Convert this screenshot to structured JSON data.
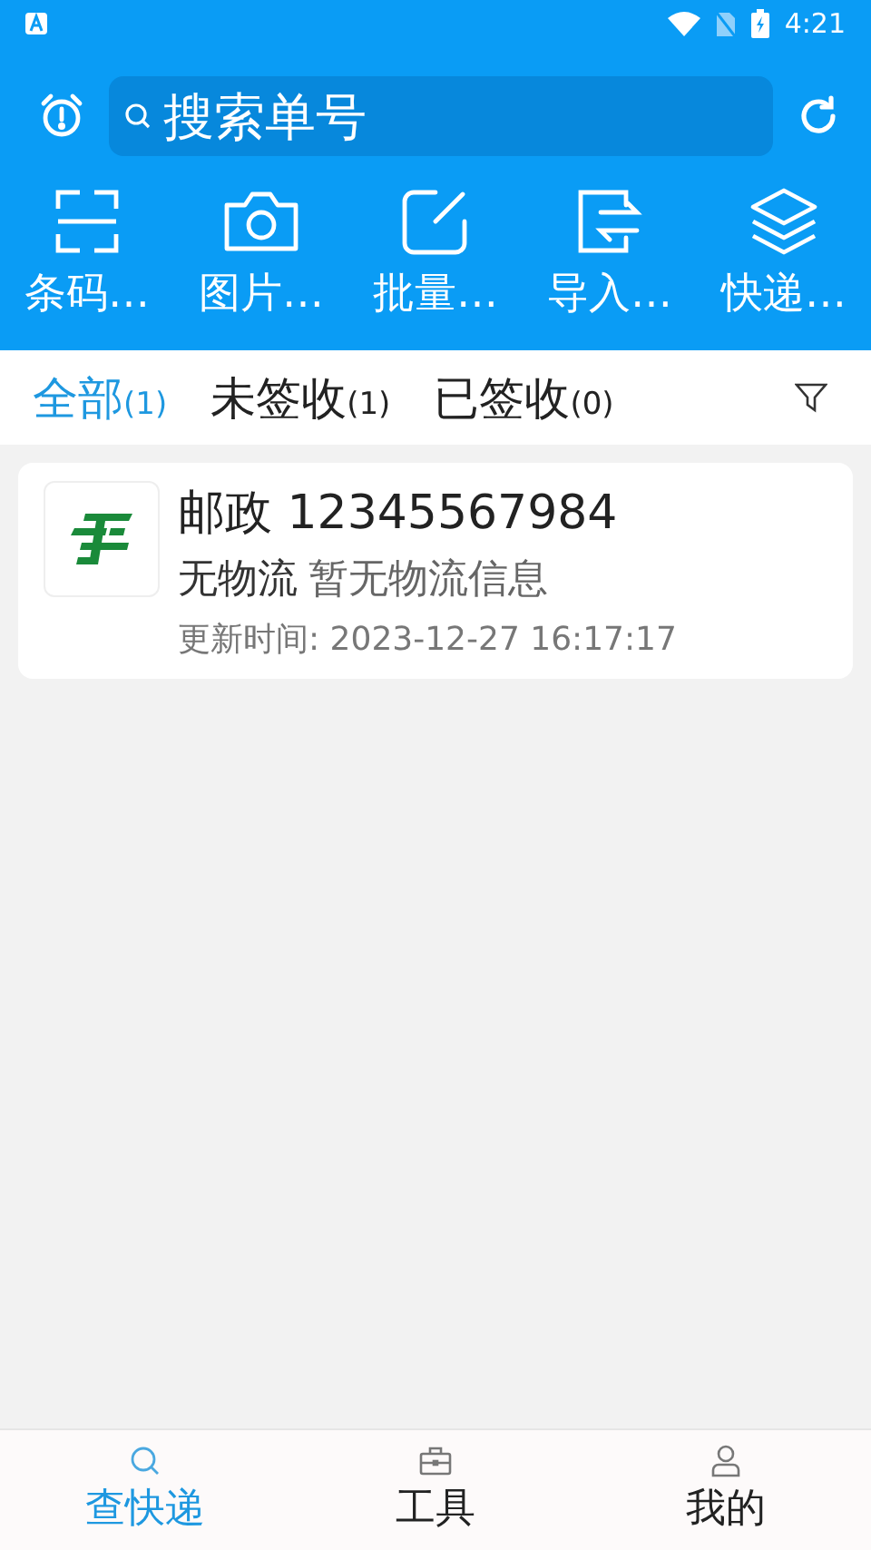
{
  "status_bar": {
    "time": "4:21"
  },
  "search": {
    "placeholder": "搜索单号"
  },
  "tools": [
    {
      "kind": "scan",
      "label": "条码…"
    },
    {
      "kind": "camera",
      "label": "图片…"
    },
    {
      "kind": "edit",
      "label": "批量…"
    },
    {
      "kind": "import",
      "label": "导入…"
    },
    {
      "kind": "layers",
      "label": "快递…"
    }
  ],
  "tabs": [
    {
      "label": "全部",
      "count": "(1)",
      "selected": true
    },
    {
      "label": "未签收",
      "count": "(1)",
      "selected": false
    },
    {
      "label": "已签收",
      "count": "(0)",
      "selected": false
    }
  ],
  "parcels": [
    {
      "carrier": "邮政",
      "number": "12345567984",
      "status": "无物流",
      "detail": "暂无物流信息",
      "updated": "更新时间: 2023-12-27 16:17:17"
    }
  ],
  "bottom_nav": [
    {
      "kind": "search",
      "label": "查快递",
      "selected": true
    },
    {
      "kind": "toolbox",
      "label": "工具",
      "selected": false
    },
    {
      "kind": "user",
      "label": "我的",
      "selected": false
    }
  ]
}
